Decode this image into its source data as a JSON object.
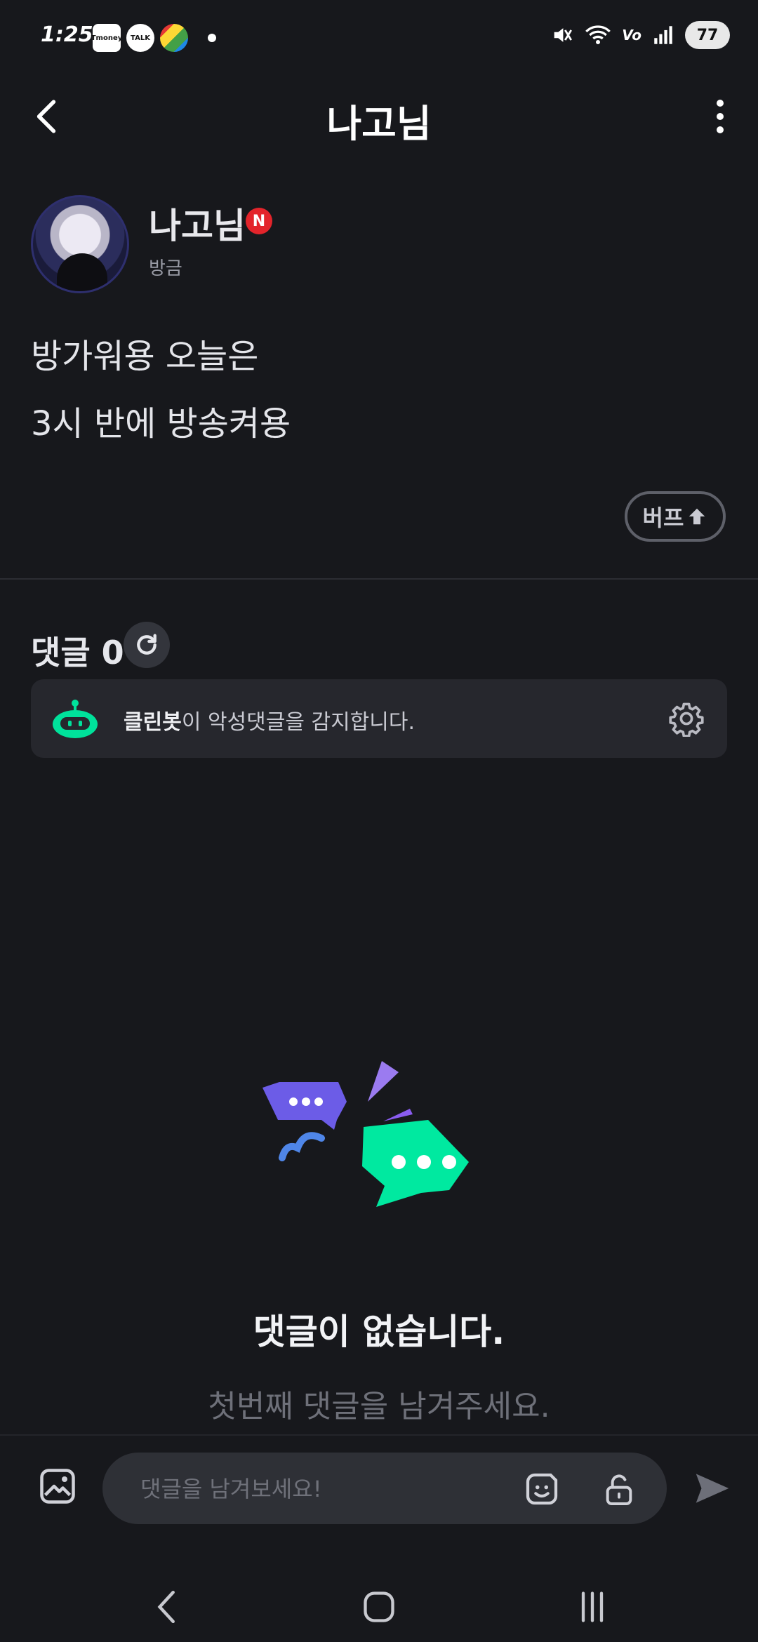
{
  "status_bar": {
    "time": "1:25",
    "apps": [
      "Tmoney",
      "TALK"
    ],
    "battery": "77"
  },
  "appbar": {
    "title": "나고님",
    "back_icon": "chevron-left-icon",
    "more_icon": "more-vertical-icon"
  },
  "post": {
    "author": "나고님",
    "badge": "N",
    "time": "방금",
    "body_lines": [
      "방가워용 오늘은",
      "3시 반에 방송켜용"
    ],
    "buff_label": "버프"
  },
  "comments": {
    "label": "댓글",
    "count": "0",
    "cleanbot_strong": "클린봇",
    "cleanbot_text": "이 악성댓글을 감지합니다.",
    "empty_title": "댓글이 없습니다.",
    "empty_subtitle": "첫번째 댓글을 남겨주세요."
  },
  "composer": {
    "placeholder": "댓글을 남겨보세요!"
  },
  "colors": {
    "background": "#17181c",
    "accent_green": "#00e29b",
    "accent_purple": "#6c5ce7",
    "badge_red": "#e3242b"
  }
}
